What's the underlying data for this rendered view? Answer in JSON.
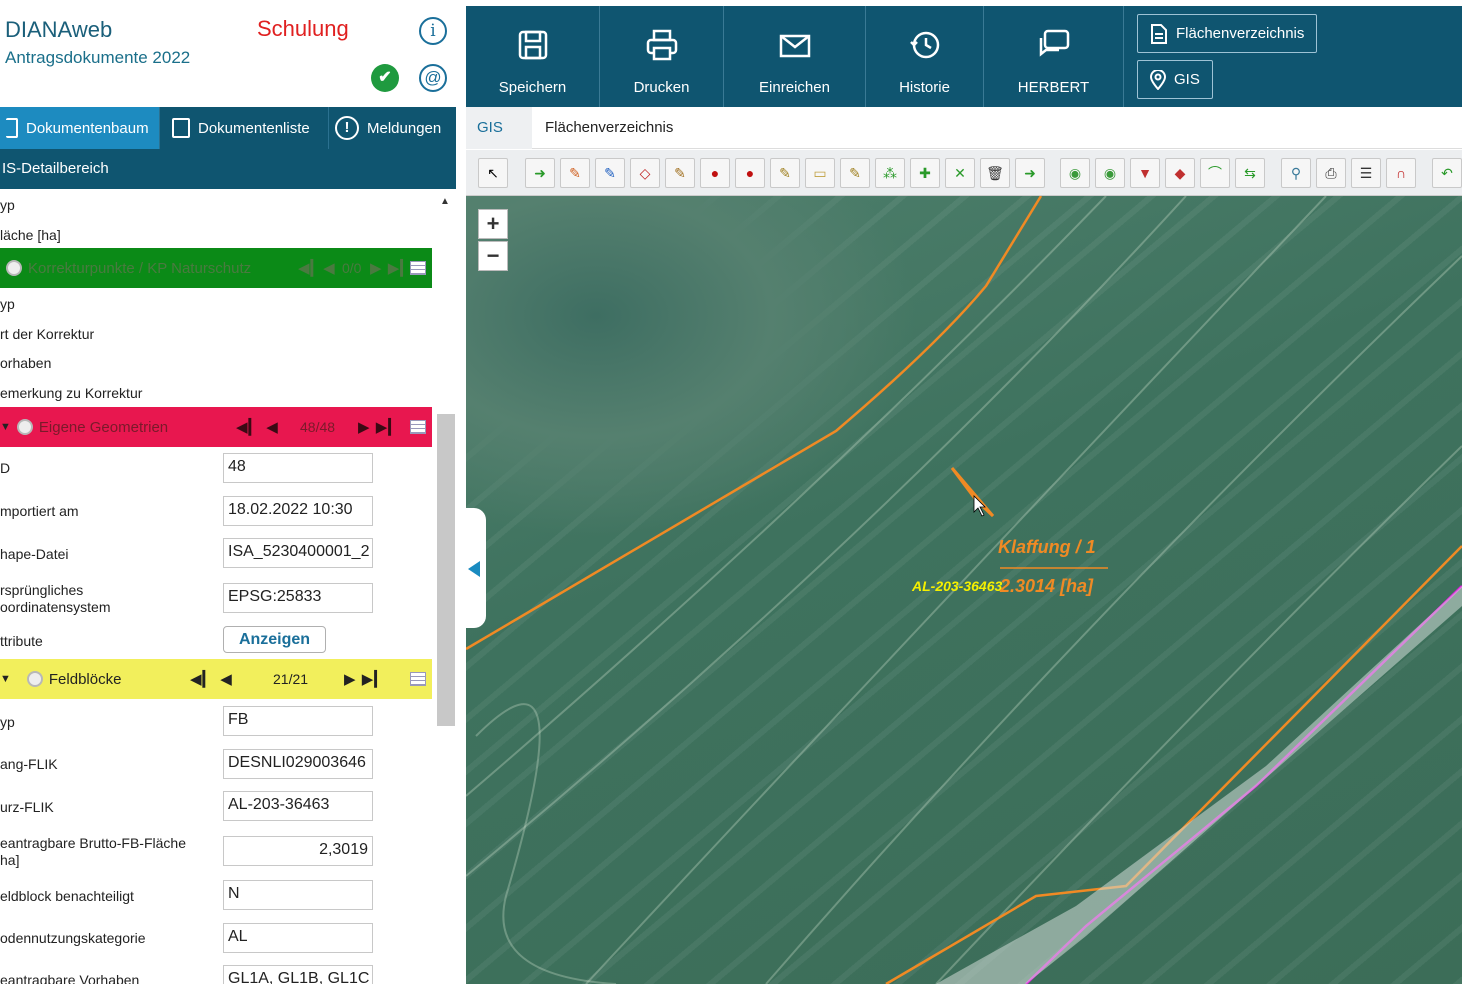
{
  "header": {
    "app_title": "DIANAweb",
    "app_subtitle": "Antragsdokumente 2022",
    "mode": "Schulung",
    "info_glyph": "i",
    "check_glyph": "✔",
    "at_glyph": "@"
  },
  "tabs": [
    {
      "label": "Dokumentenbaum",
      "active": true
    },
    {
      "label": "Dokumentenliste",
      "active": false
    },
    {
      "label": "Meldungen",
      "active": false
    }
  ],
  "detail_header": "IS-Detailbereich",
  "top_fields": [
    {
      "label": "yp"
    },
    {
      "label": "läche [ha]"
    }
  ],
  "korrektur": {
    "title": "Korrekturpunkte / KP Naturschutz",
    "count": "0/0",
    "labels": [
      "yp",
      "rt der Korrektur",
      "orhaben",
      "emerkung zu Korrektur"
    ]
  },
  "eigene": {
    "title": "Eigene Geometrien",
    "count": "48/48",
    "fields": [
      {
        "label": "D",
        "value": "48"
      },
      {
        "label": "mportiert am",
        "value": "18.02.2022 10:30"
      },
      {
        "label": "hape-Datei",
        "value": "ISA_5230400001_2"
      },
      {
        "label": "rsprüngliches\noordinatensystem",
        "value": "EPSG:25833"
      }
    ],
    "attribute_label": "ttribute",
    "attribute_button": "Anzeigen"
  },
  "feldbloecke": {
    "title": "Feldblöcke",
    "count": "21/21",
    "fields": [
      {
        "label": "yp",
        "value": "FB"
      },
      {
        "label": "ang-FLIK",
        "value": "DESNLI029003646"
      },
      {
        "label": "urz-FLIK",
        "value": "AL-203-36463"
      },
      {
        "label": "eantragbare Brutto-FB-Fläche\nha]",
        "value": "2,3019"
      },
      {
        "label": "eldblock benachteiligt",
        "value": "N"
      },
      {
        "label": "odennutzungskategorie",
        "value": "AL"
      },
      {
        "label": "eantragbare Vorhaben",
        "value": "GL1A, GL1B, GL1C"
      }
    ]
  },
  "topnav": [
    {
      "label": "Speichern",
      "icon": "save-icon"
    },
    {
      "label": "Drucken",
      "icon": "print-icon"
    },
    {
      "label": "Einreichen",
      "icon": "send-icon"
    },
    {
      "label": "Historie",
      "icon": "history-icon"
    },
    {
      "label": "HERBERT",
      "icon": "chat-icon"
    }
  ],
  "side_buttons": [
    {
      "label": "Flächenverzeichnis",
      "icon": "document-icon"
    },
    {
      "label": "GIS",
      "icon": "location-pin-icon"
    }
  ],
  "breadcrumb": {
    "gis": "GIS",
    "current": "Flächenverzeichnis"
  },
  "map": {
    "zoom_in": "+",
    "zoom_out": "−",
    "parcel_label": "Klaffung / 1",
    "parcel_area": "2.3014 [ha]",
    "flik_label": "AL-203-36463",
    "colors": {
      "boundary": "#f08a24",
      "magenta": "#e020e0",
      "flik": "#f5f000"
    }
  }
}
